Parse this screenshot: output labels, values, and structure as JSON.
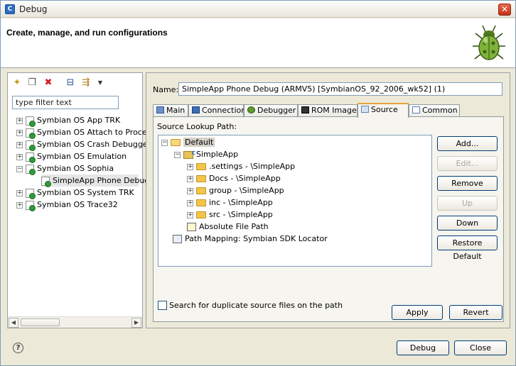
{
  "window": {
    "title": "Debug",
    "close": "✕"
  },
  "header": {
    "title": "Create, manage, and run configurations"
  },
  "left": {
    "filter_placeholder": "type filter text",
    "items": [
      {
        "label": "Symbian OS App TRK"
      },
      {
        "label": "Symbian OS Attach to Proces"
      },
      {
        "label": "Symbian OS Crash Debugger"
      },
      {
        "label": "Symbian OS Emulation"
      },
      {
        "label": "Symbian OS Sophia"
      },
      {
        "label": "SimpleApp Phone Debug"
      },
      {
        "label": "Symbian OS System TRK"
      },
      {
        "label": "Symbian OS Trace32"
      }
    ]
  },
  "right": {
    "name_label": "Name:",
    "name_value": "SimpleApp Phone Debug (ARMV5) [SymbianOS_92_2006_wk52] (1)",
    "tabs": [
      {
        "label": "Main"
      },
      {
        "label": "Connection"
      },
      {
        "label": "Debugger"
      },
      {
        "label": "ROM Image"
      },
      {
        "label": "Source"
      },
      {
        "label": "Common"
      }
    ],
    "source_lookup_label": "Source Lookup Path:",
    "tree": {
      "default": "Default",
      "project": "SimpleApp",
      "folders": [
        ".settings - \\SimpleApp",
        "Docs - \\SimpleApp",
        "group - \\SimpleApp",
        "inc - \\SimpleApp",
        "src - \\SimpleApp"
      ],
      "absolute": "Absolute File Path",
      "mapping": "Path Mapping: Symbian SDK Locator"
    },
    "buttons": {
      "add": "Add...",
      "edit": "Edit...",
      "remove": "Remove",
      "up": "Up",
      "down": "Down",
      "restore": "Restore Default"
    },
    "duplicate_label": "Search for duplicate source files on the path",
    "apply": "Apply",
    "revert": "Revert"
  },
  "footer": {
    "debug": "Debug",
    "close": "Close",
    "help": "?"
  }
}
